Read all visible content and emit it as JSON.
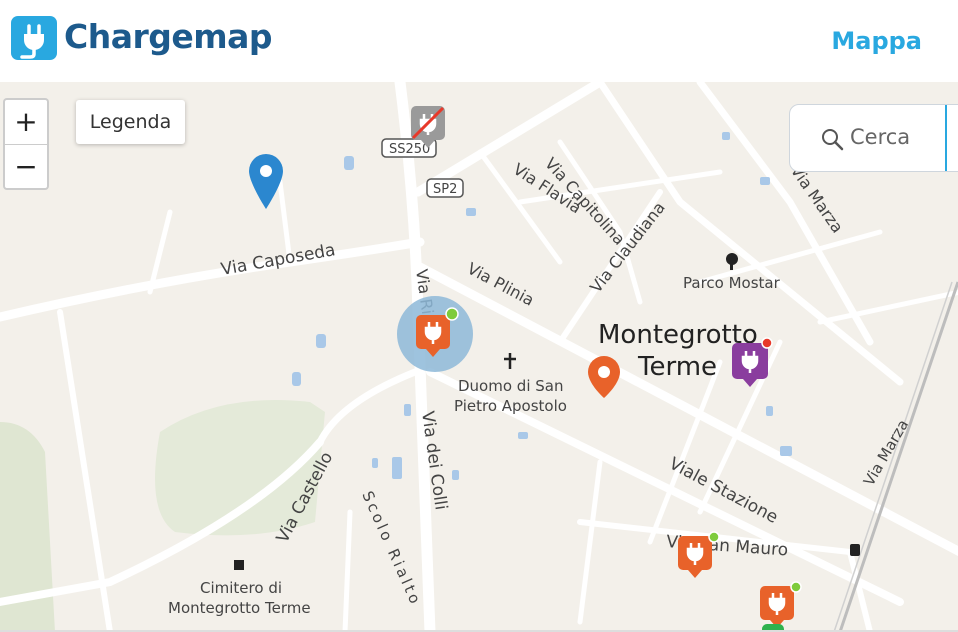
{
  "header": {
    "brand_name": "Chargemap",
    "nav_map_label": "Mappa"
  },
  "map_controls": {
    "zoom_in": "+",
    "zoom_out": "−",
    "legend_label": "Legenda",
    "search_label": "Cerca"
  },
  "map_labels": {
    "ss250": "SS250",
    "sp2": "SP2",
    "via_caposeda": "Via Caposeda",
    "via_plinia": "Via Plinia",
    "via_flavia": "Via Flavia",
    "via_capitolina": "Via Capitolina",
    "via_claudiana": "Via Claudiana",
    "via_marza_top": "Via Marza",
    "via_marza_bottom": "Via Marza",
    "parco_mostar": "Parco Mostar",
    "town_line1": "Montegrotto",
    "town_line2": "Terme",
    "duomo_line1": "Duomo di San",
    "duomo_line2": "Pietro Apostolo",
    "viale_stazione": "Viale Stazione",
    "via_s_mauro": "Via San Mauro",
    "via_dei_colli": "Via dei Colli",
    "via_ri": "Via Ri",
    "via_castello": "Via Castello",
    "scolo_rialto": "Scolo Rialto",
    "cimitero_line1": "Cimitero di",
    "cimitero_line2": "Montegrotto Terme"
  },
  "colors": {
    "brand_blue": "#29a8e0",
    "brand_dark": "#1d5a8c",
    "station_orange": "#e8622a",
    "station_purple": "#8a3d9e",
    "status_green": "#7ecb3c",
    "status_red": "#e8392a",
    "pin_blue": "#2b87cf"
  }
}
